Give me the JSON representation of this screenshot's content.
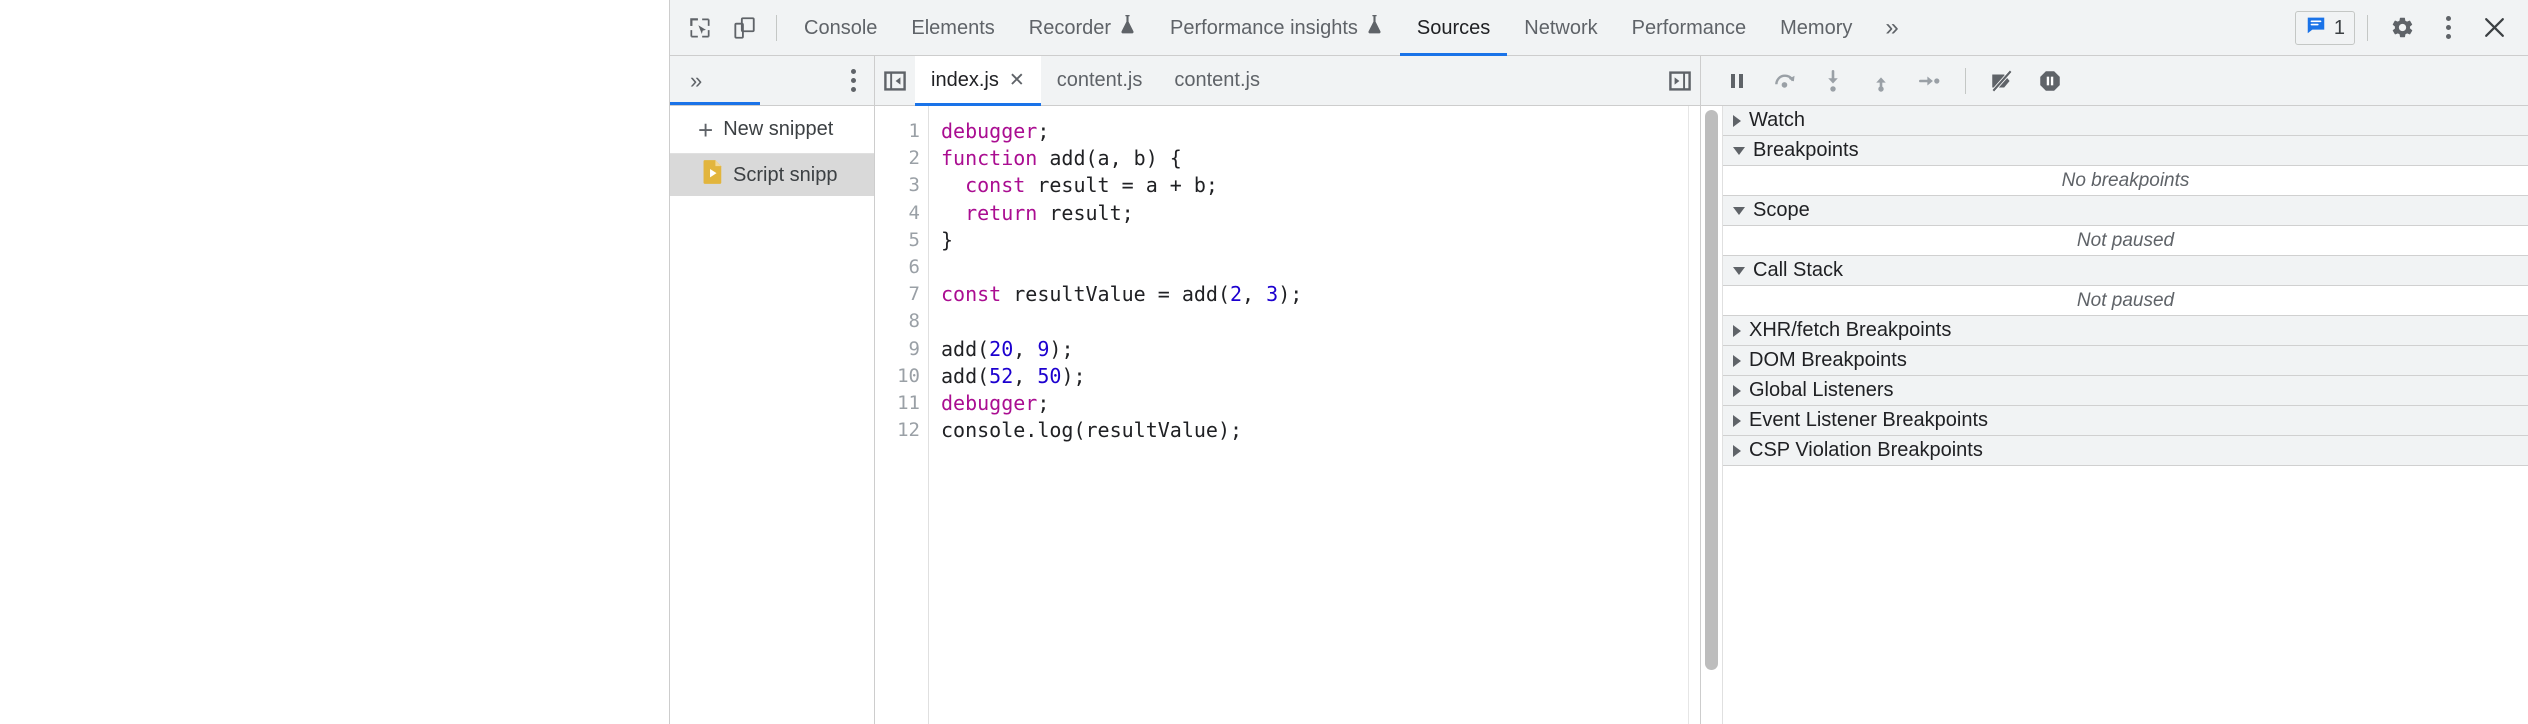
{
  "window": {
    "app": "Chrome DevTools"
  },
  "main_toolbar": {
    "inspect_icon": "inspect-element-icon",
    "device_icon": "device-toolbar-icon",
    "tabs": [
      {
        "label": "Console",
        "icon": "",
        "active": false
      },
      {
        "label": "Elements",
        "icon": "",
        "active": false
      },
      {
        "label": "Recorder",
        "icon": "flask-icon",
        "active": false
      },
      {
        "label": "Performance insights",
        "icon": "flask-icon",
        "active": false
      },
      {
        "label": "Sources",
        "icon": "",
        "active": true
      },
      {
        "label": "Network",
        "icon": "",
        "active": false
      },
      {
        "label": "Performance",
        "icon": "",
        "active": false
      },
      {
        "label": "Memory",
        "icon": "",
        "active": false
      }
    ],
    "more_tabs_label": "»",
    "issues": {
      "icon": "issues-message-icon",
      "count": "1"
    },
    "settings_icon": "gear-icon",
    "more_options_icon": "more-vertical-icon",
    "close_icon": "close-icon"
  },
  "navigator": {
    "more_panels_label": "»",
    "more_options_icon": "more-vertical-icon",
    "new_snippet_label": "New snippet",
    "new_snippet_icon": "plus-icon",
    "items": [
      {
        "label": "Script snipp",
        "icon": "script-snippet-icon",
        "selected": true
      }
    ]
  },
  "editor": {
    "prev_nav_icon": "panel-collapse-left-icon",
    "next_nav_icon": "panel-expand-right-icon",
    "tabs": [
      {
        "label": "index.js",
        "active": true,
        "closable": true,
        "close_label": "✕"
      },
      {
        "label": "content.js",
        "active": false,
        "closable": false,
        "close_label": ""
      },
      {
        "label": "content.js",
        "active": false,
        "closable": false,
        "close_label": ""
      }
    ],
    "line_numbers": [
      "1",
      "2",
      "3",
      "4",
      "5",
      "6",
      "7",
      "8",
      "9",
      "10",
      "11",
      "12"
    ],
    "lines": [
      [
        {
          "t": "debugger",
          "c": "kw"
        },
        {
          "t": ";",
          "c": ""
        }
      ],
      [
        {
          "t": "function",
          "c": "kw"
        },
        {
          "t": " add(a, b) {",
          "c": ""
        }
      ],
      [
        {
          "t": "  ",
          "c": ""
        },
        {
          "t": "const",
          "c": "kw"
        },
        {
          "t": " result = a + b;",
          "c": ""
        }
      ],
      [
        {
          "t": "  ",
          "c": ""
        },
        {
          "t": "return",
          "c": "kw"
        },
        {
          "t": " result;",
          "c": ""
        }
      ],
      [
        {
          "t": "}",
          "c": ""
        }
      ],
      [
        {
          "t": "",
          "c": ""
        }
      ],
      [
        {
          "t": "const",
          "c": "kw"
        },
        {
          "t": " resultValue = add(",
          "c": ""
        },
        {
          "t": "2",
          "c": "num"
        },
        {
          "t": ", ",
          "c": ""
        },
        {
          "t": "3",
          "c": "num"
        },
        {
          "t": ");",
          "c": ""
        }
      ],
      [
        {
          "t": "",
          "c": ""
        }
      ],
      [
        {
          "t": "add(",
          "c": ""
        },
        {
          "t": "20",
          "c": "num"
        },
        {
          "t": ", ",
          "c": ""
        },
        {
          "t": "9",
          "c": "num"
        },
        {
          "t": ");",
          "c": ""
        }
      ],
      [
        {
          "t": "add(",
          "c": ""
        },
        {
          "t": "52",
          "c": "num"
        },
        {
          "t": ", ",
          "c": ""
        },
        {
          "t": "50",
          "c": "num"
        },
        {
          "t": ");",
          "c": ""
        }
      ],
      [
        {
          "t": "debugger",
          "c": "kw"
        },
        {
          "t": ";",
          "c": ""
        }
      ],
      [
        {
          "t": "console.log(resultValue);",
          "c": ""
        }
      ]
    ]
  },
  "debugger_pane": {
    "toolbar": [
      {
        "name": "resume-script-execution-icon"
      },
      {
        "name": "step-over-next-function-call-icon"
      },
      {
        "name": "step-into-next-function-call-icon"
      },
      {
        "name": "step-out-of-current-function-icon"
      },
      {
        "name": "step-icon"
      },
      {
        "name": "separator"
      },
      {
        "name": "deactivate-breakpoints-icon"
      },
      {
        "name": "pause-on-exceptions-icon"
      }
    ],
    "sections": [
      {
        "title": "Watch",
        "expanded": false,
        "body": null
      },
      {
        "title": "Breakpoints",
        "expanded": true,
        "body": "No breakpoints"
      },
      {
        "title": "Scope",
        "expanded": true,
        "body": "Not paused"
      },
      {
        "title": "Call Stack",
        "expanded": true,
        "body": "Not paused"
      },
      {
        "title": "XHR/fetch Breakpoints",
        "expanded": false,
        "body": null
      },
      {
        "title": "DOM Breakpoints",
        "expanded": false,
        "body": null
      },
      {
        "title": "Global Listeners",
        "expanded": false,
        "body": null
      },
      {
        "title": "Event Listener Breakpoints",
        "expanded": false,
        "body": null
      },
      {
        "title": "CSP Violation Breakpoints",
        "expanded": false,
        "body": null
      }
    ]
  },
  "colors": {
    "accent": "#1a73e8",
    "toolbar_bg": "#f1f3f4",
    "border": "#cdcdcd",
    "keyword": "#aa0d91",
    "number": "#1c00cf",
    "snippet_icon": "#e2b53d",
    "selected_row": "#d9d9d9"
  }
}
